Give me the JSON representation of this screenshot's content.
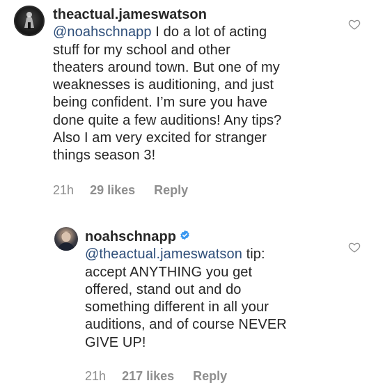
{
  "comments": [
    {
      "username": "theactual.jameswatson",
      "mention": "@noahschnapp",
      "lines": [
        " I do a lot of acting",
        "stuff for my school and other",
        "theaters around town. But one of my",
        "weaknesses is auditioning, and just",
        "being confident. I’m sure you have",
        "done quite a few auditions! Any tips?",
        "Also I am very excited for stranger",
        "things season  3!"
      ],
      "time": "21h",
      "likes": "29 likes",
      "reply": "Reply"
    },
    {
      "username": "noahschnapp",
      "verified": true,
      "mention": "@theactual.jameswatson",
      "lines": [
        " tip:",
        "accept ANYTHING you get",
        "offered, stand out and do",
        "something different in all your",
        "auditions, and of course NEVER",
        "GIVE UP!"
      ],
      "time": "21h",
      "likes": "217 likes",
      "reply": "Reply"
    }
  ],
  "icons": {
    "like": "heart-outline-icon",
    "verified": "verified-badge-icon"
  },
  "colors": {
    "text": "#262626",
    "mention": "#2f4f7a",
    "meta": "#8e8e8e",
    "verified": "#3897f0"
  }
}
